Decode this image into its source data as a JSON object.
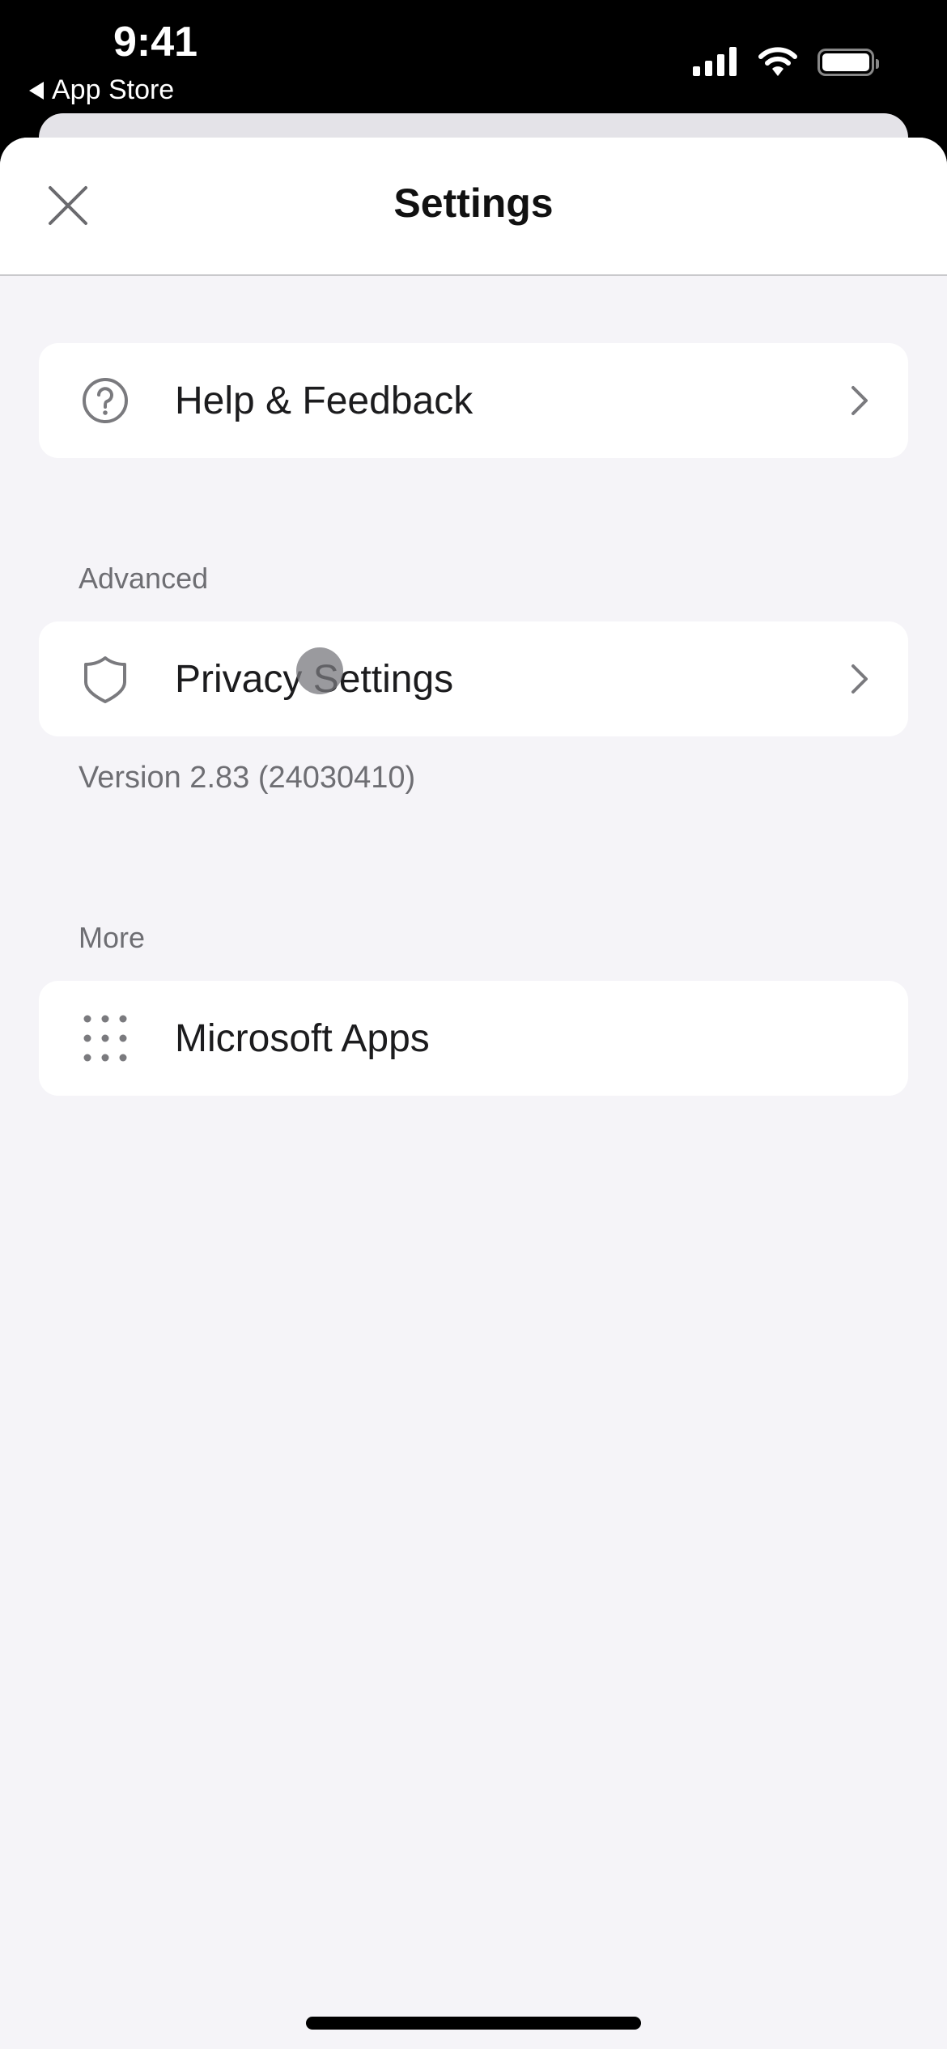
{
  "status_bar": {
    "time": "9:41",
    "back_label": "App Store",
    "icons": [
      "cellular-signal-icon",
      "wifi-icon",
      "battery-icon"
    ]
  },
  "header": {
    "title": "Settings",
    "close_icon": "close-icon"
  },
  "sections": [
    {
      "header": "",
      "items": [
        {
          "label": "Help & Feedback",
          "icon": "help-circle-icon",
          "chevron": true
        }
      ]
    },
    {
      "header": "Advanced",
      "items": [
        {
          "label": "Privacy Settings",
          "icon": "shield-icon",
          "chevron": true
        }
      ],
      "footer": "Version 2.83 (24030410)"
    },
    {
      "header": "More",
      "items": [
        {
          "label": "Microsoft Apps",
          "icon": "grid-dots-icon",
          "chevron": false
        }
      ]
    }
  ],
  "colors": {
    "background": "#f5f4f8",
    "card": "#ffffff",
    "text_primary": "#1c1c1e",
    "text_secondary": "#6e6e73",
    "icon_gray": "#7a7a7e"
  }
}
